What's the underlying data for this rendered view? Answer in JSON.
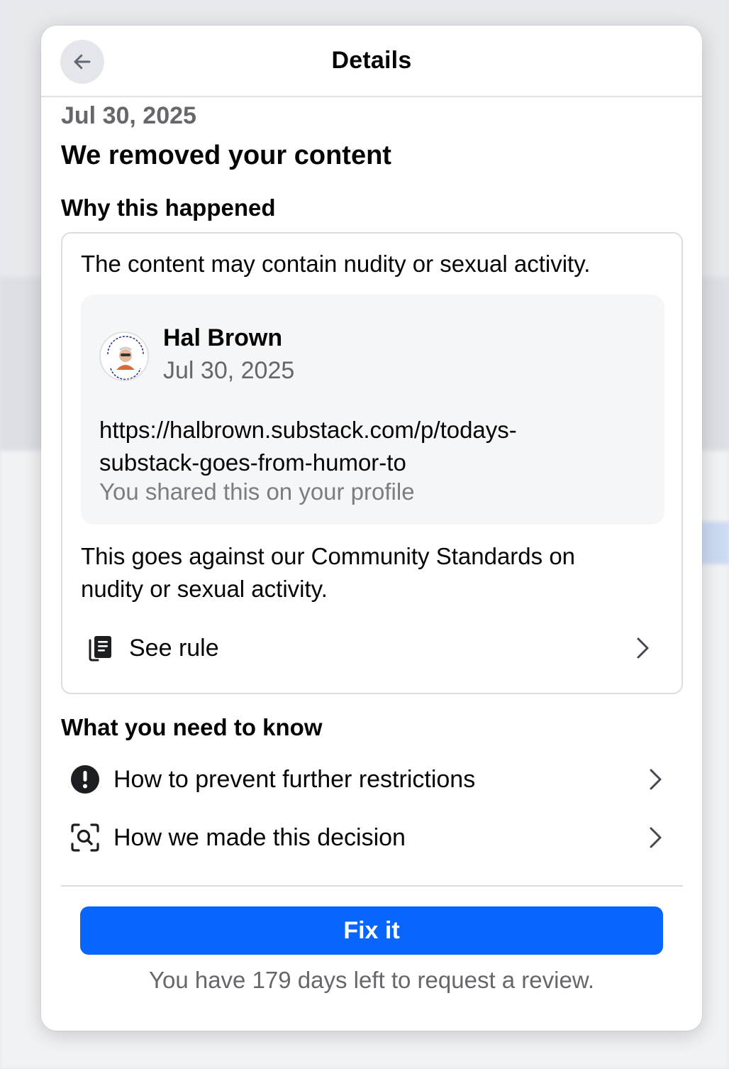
{
  "header": {
    "title": "Details",
    "back_icon": "arrow-left-icon"
  },
  "notice": {
    "date": "Jul 30, 2025",
    "title": "We removed your content"
  },
  "why": {
    "title": "Why this happened",
    "reason": "The content may contain nudity or sexual activity.",
    "post": {
      "author": "Hal Brown",
      "date": "Jul 30, 2025",
      "link_line1": "https://halbrown.substack.com/p/todays-",
      "link_line2": "substack-goes-from-humor-to",
      "shared_note": "You shared this on your profile"
    },
    "standards_line1": "This goes against our Community Standards on",
    "standards_line2": "nudity or sexual activity.",
    "see_rule": {
      "label": "See rule",
      "icon": "rulebook-icon"
    }
  },
  "know": {
    "title": "What you need to know",
    "items": [
      {
        "label": "How to prevent further restrictions",
        "icon": "alert-circle-icon"
      },
      {
        "label": "How we made this decision",
        "icon": "scan-search-icon"
      }
    ]
  },
  "footer": {
    "button_label": "Fix it",
    "review_note": "You have 179 days left to request a review."
  },
  "colors": {
    "primary": "#0866ff",
    "secondary_text": "#65676b",
    "card_bg": "#f5f6f8"
  }
}
